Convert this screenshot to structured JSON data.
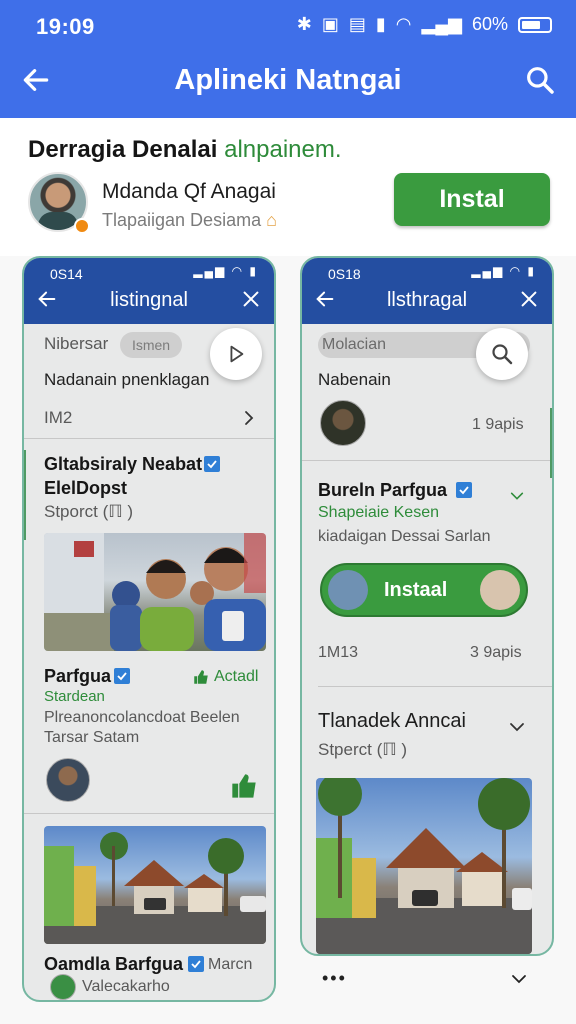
{
  "status_bar": {
    "time": "19:09",
    "battery_text": "60%",
    "battery_level": 0.6
  },
  "app_bar": {
    "title": "Aplineki Natngai"
  },
  "headline": {
    "main": "Derragia Denalai",
    "accent": "alnpainem."
  },
  "profile": {
    "name": "Mdanda Qf Anagai",
    "subtitle": "Tlapaiigan Desiama"
  },
  "install_button": {
    "label": "Instal"
  },
  "card_left": {
    "time": "0S14",
    "title": "listingnal",
    "search_label": "Nibersar",
    "search_pill": "Ismen",
    "row1": "Nadanain pnenklagan",
    "row2": "IM2",
    "post1": {
      "title_line1": "Gltabsiraly Neabat",
      "title_line2": "ElelDopst",
      "sub": "Stporct (ℿ )"
    },
    "post2": {
      "name": "Parfgua",
      "action": "Actadl",
      "sub": "Stardean",
      "desc_line1": "Plreanoncolancdoat Beelen",
      "desc_line2": "Tarsar Satam"
    },
    "post3": {
      "name": "Oamdla Barfgua",
      "tag": "Marcn",
      "sub": "Valecakarho"
    }
  },
  "card_right": {
    "time": "0S18",
    "title": "llsthragal",
    "search_label": "Molacian",
    "row1": "Nabenain",
    "row1_meta": "1 9apis",
    "post1": {
      "name": "Bureln Parfgua",
      "sub": "Shapeiaie Kesen",
      "desc": "kiadaigan Dessai Sarlan"
    },
    "install_pill": {
      "label": "Instaal"
    },
    "row2": "1M13",
    "row2_meta": "3 9apis",
    "post2": {
      "title": "Tlanadek Anncai",
      "sub": "Stperct (ℿ )"
    },
    "footer_more": "•••"
  },
  "colors": {
    "primary_blue": "#3f6fe9",
    "card_header_blue": "#244ea1",
    "install_green": "#3a9b3f",
    "accent_green": "#2e8b3a"
  },
  "icons": [
    "back-arrow-icon",
    "search-icon",
    "close-icon",
    "play-icon",
    "chevron-right-icon",
    "chevron-down-icon",
    "verified-icon",
    "thumbs-up-icon",
    "wifi-icon",
    "signal-icon",
    "bluetooth-icon",
    "battery-icon"
  ]
}
